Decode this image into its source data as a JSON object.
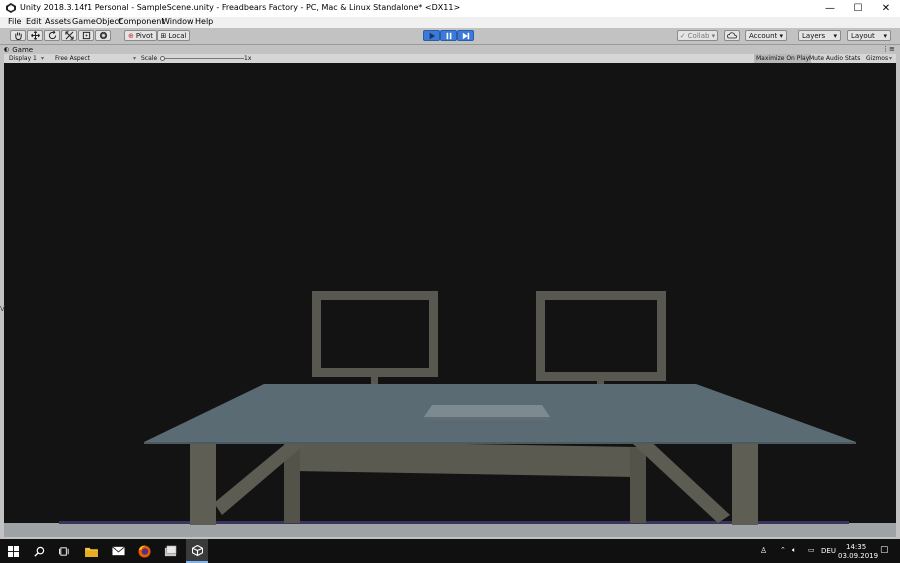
{
  "window": {
    "title": "Unity 2018.3.14f1 Personal - SampleScene.unity - Freadbears Factory - PC, Mac & Linux Standalone* <DX11>",
    "minimize": "—",
    "maximize": "☐",
    "close": "✕"
  },
  "menu": [
    "File",
    "Edit",
    "Assets",
    "GameObject",
    "Component",
    "Window",
    "Help"
  ],
  "toolbar": {
    "pivot": "Pivot",
    "local": "Local",
    "collab": "Collab ▾",
    "account": "Account",
    "layers": "Layers",
    "layout": "Layout",
    "play_active": true
  },
  "game_view": {
    "tab_label": "Game",
    "display": "Display 1",
    "aspect": "Free Aspect",
    "scale_label": "Scale",
    "scale_value": "1x",
    "maximize_on_play": "Maximize On Play",
    "mute_audio": "Mute Audio",
    "stats": "Stats",
    "gizmos": "Gizmos"
  },
  "taskbar": {
    "language": "DEU",
    "time": "14:35",
    "date": "03.09.2019"
  },
  "colors": {
    "viewport_bg": "#131313",
    "desk_top": "#5a6b73",
    "desk_frame": "#5b5a50",
    "monitor_frame": "#585750",
    "play_blue": "#3b7ad9",
    "floor": "#9ea4a6"
  }
}
